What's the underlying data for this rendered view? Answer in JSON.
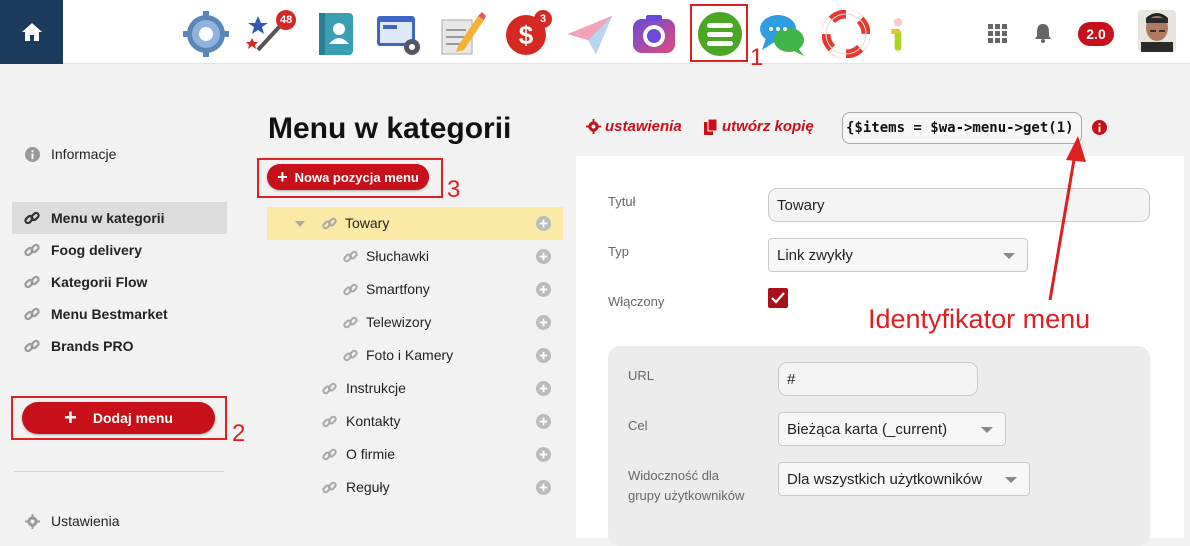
{
  "topbar": {
    "apps": [
      {
        "icon": "settings-app-icon",
        "badge": ""
      },
      {
        "icon": "magic-wand-app-icon",
        "badge": "48"
      },
      {
        "icon": "contacts-app-icon",
        "badge": ""
      },
      {
        "icon": "site-app-icon",
        "badge": ""
      },
      {
        "icon": "blog-app-icon",
        "badge": ""
      },
      {
        "icon": "shop-app-icon",
        "badge": "3"
      },
      {
        "icon": "mailer-app-icon",
        "badge": ""
      },
      {
        "icon": "photos-app-icon",
        "badge": ""
      },
      {
        "icon": "menu-app-icon",
        "badge": ""
      },
      {
        "icon": "chat-app-icon",
        "badge": ""
      },
      {
        "icon": "helpdesk-app-icon",
        "badge": ""
      },
      {
        "icon": "info-app-icon",
        "badge": ""
      }
    ],
    "version": "2.0"
  },
  "annotations": {
    "n1": "1",
    "n2": "2",
    "n3": "3",
    "identifier": "Identyfikator menu"
  },
  "sidebar": {
    "info": "Informacje",
    "items": [
      "Menu w kategorii",
      "Foog delivery",
      "Kategorii Flow",
      "Menu Bestmarket",
      "Brands PRO"
    ],
    "add_menu": "Dodaj menu",
    "settings": "Ustawienia"
  },
  "header": {
    "title": "Menu w kategorii",
    "settings_link": "ustawienia",
    "copy_link": "utwórz kopię",
    "code": "{$items = $wa->menu->get(1)"
  },
  "tree": {
    "new_item": "Nowa pozycja menu",
    "items": [
      {
        "label": "Towary",
        "level": 0
      },
      {
        "label": "Słuchawki",
        "level": 1
      },
      {
        "label": "Smartfony",
        "level": 1
      },
      {
        "label": "Telewizory",
        "level": 1
      },
      {
        "label": "Foto i Kamery",
        "level": 1
      },
      {
        "label": "Instrukcje",
        "level": 0
      },
      {
        "label": "Kontakty",
        "level": 0
      },
      {
        "label": "O firmie",
        "level": 0
      },
      {
        "label": "Reguły",
        "level": 0
      }
    ]
  },
  "editor": {
    "title_label": "Tytuł",
    "title_value": "Towary",
    "type_label": "Typ",
    "type_value": "Link zwykły",
    "enabled_label": "Włączony",
    "url_label": "URL",
    "url_value": "#",
    "target_label": "Cel",
    "target_value": "Bieżąca karta (_current)",
    "visibility_label": "Widoczność dla grupy użytkowników",
    "visibility_value": "Dla wszystkich użytkowników"
  },
  "colors": {
    "accent": "#c8101a",
    "annotation": "#e02020",
    "selected_row": "#fbe9a6",
    "home_bg": "#1c3a5b"
  }
}
